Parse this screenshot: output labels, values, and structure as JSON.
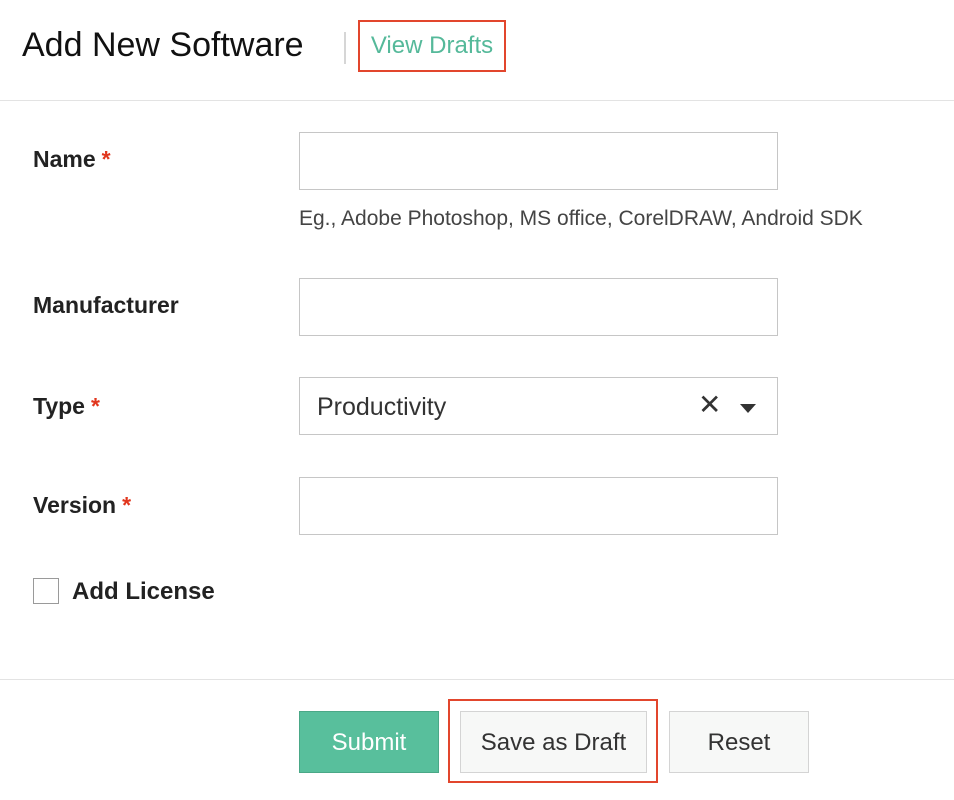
{
  "header": {
    "title": "Add New Software",
    "view_drafts": "View Drafts"
  },
  "form": {
    "name": {
      "label": "Name",
      "required_mark": "*",
      "value": "",
      "hint": "Eg., Adobe Photoshop, MS office, CorelDRAW, Android SDK"
    },
    "manufacturer": {
      "label": "Manufacturer",
      "value": ""
    },
    "type": {
      "label": "Type",
      "required_mark": "*",
      "selected": "Productivity",
      "clear_symbol": "✕"
    },
    "version": {
      "label": "Version",
      "required_mark": "*",
      "value": ""
    },
    "add_license": {
      "label": "Add License",
      "checked": false
    }
  },
  "actions": {
    "submit": "Submit",
    "save_as_draft": "Save as Draft",
    "reset": "Reset"
  },
  "colors": {
    "accent": "#55b99a",
    "submit_bg": "#58bf9c",
    "required": "#e1361d",
    "highlight": "#e2462d"
  }
}
